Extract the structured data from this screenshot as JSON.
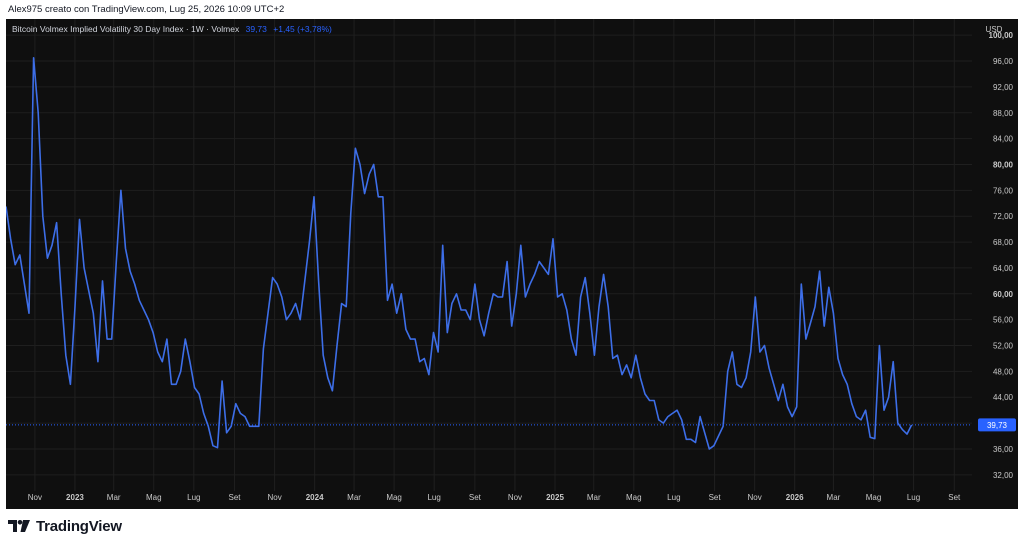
{
  "header": {
    "text": "Alex975 creato con TradingView.com, Lug 25, 2026 10:09 UTC+2"
  },
  "legend": {
    "title": "Bitcoin Volmex Implied Volatility 30 Day Index · 1W · Volmex",
    "last_value": "39,73",
    "change": "+1,45 (+3,78%)"
  },
  "footer": {
    "brand": "TradingView"
  },
  "colors": {
    "background": "#0f0f0f",
    "line": "#3d6ee8",
    "last_value_badge": "#2962ff",
    "grid": "#1f1f1f",
    "axis_text": "#c9c9c9"
  },
  "chart_data": {
    "type": "line",
    "title": "Bitcoin Volmex Implied Volatility 30 Day Index · 1W · Volmex",
    "currency": "USD",
    "ylim": [
      29.5,
      102.5
    ],
    "yticks": [
      "32,00",
      "36,00",
      "40,00",
      "44,00",
      "48,00",
      "52,00",
      "56,00",
      "60,00",
      "64,00",
      "68,00",
      "72,00",
      "76,00",
      "80,00",
      "84,00",
      "88,00",
      "92,00",
      "96,00",
      "100,00"
    ],
    "ytick_values": [
      32,
      36,
      40,
      44,
      48,
      52,
      56,
      60,
      64,
      68,
      72,
      76,
      80,
      84,
      88,
      92,
      96,
      100
    ],
    "bold_yticks": [
      "40,00",
      "60,00",
      "80,00",
      "100,00"
    ],
    "x_start": "2022-09-18",
    "x_end": "2026-09-28",
    "xticks": [
      {
        "date": "2022-11-01",
        "label": "Nov",
        "bold": false
      },
      {
        "date": "2023-01-01",
        "label": "2023",
        "bold": true
      },
      {
        "date": "2023-03-01",
        "label": "Mar",
        "bold": false
      },
      {
        "date": "2023-05-01",
        "label": "Mag",
        "bold": false
      },
      {
        "date": "2023-07-01",
        "label": "Lug",
        "bold": false
      },
      {
        "date": "2023-09-01",
        "label": "Set",
        "bold": false
      },
      {
        "date": "2023-11-01",
        "label": "Nov",
        "bold": false
      },
      {
        "date": "2024-01-01",
        "label": "2024",
        "bold": true
      },
      {
        "date": "2024-03-01",
        "label": "Mar",
        "bold": false
      },
      {
        "date": "2024-05-01",
        "label": "Mag",
        "bold": false
      },
      {
        "date": "2024-07-01",
        "label": "Lug",
        "bold": false
      },
      {
        "date": "2024-09-01",
        "label": "Set",
        "bold": false
      },
      {
        "date": "2024-11-01",
        "label": "Nov",
        "bold": false
      },
      {
        "date": "2025-01-01",
        "label": "2025",
        "bold": true
      },
      {
        "date": "2025-03-01",
        "label": "Mar",
        "bold": false
      },
      {
        "date": "2025-05-01",
        "label": "Mag",
        "bold": false
      },
      {
        "date": "2025-07-01",
        "label": "Lug",
        "bold": false
      },
      {
        "date": "2025-09-01",
        "label": "Set",
        "bold": false
      },
      {
        "date": "2025-11-01",
        "label": "Nov",
        "bold": false
      },
      {
        "date": "2026-01-01",
        "label": "2026",
        "bold": true
      },
      {
        "date": "2026-03-01",
        "label": "Mar",
        "bold": false
      },
      {
        "date": "2026-05-01",
        "label": "Mag",
        "bold": false
      },
      {
        "date": "2026-07-01",
        "label": "Lug",
        "bold": false
      },
      {
        "date": "2026-09-01",
        "label": "Set",
        "bold": false
      }
    ],
    "series": [
      {
        "values": [
          {
            "x": "2022-09-18",
            "y": 73.5
          },
          {
            "x": "2022-09-25",
            "y": 68.5
          },
          {
            "x": "2022-10-02",
            "y": 64.5
          },
          {
            "x": "2022-10-09",
            "y": 66.0
          },
          {
            "x": "2022-10-23",
            "y": 57.0
          },
          {
            "x": "2022-10-30",
            "y": 96.5
          },
          {
            "x": "2022-11-06",
            "y": 88.0
          },
          {
            "x": "2022-11-13",
            "y": 72.0
          },
          {
            "x": "2022-11-20",
            "y": 65.5
          },
          {
            "x": "2022-11-27",
            "y": 67.5
          },
          {
            "x": "2022-12-04",
            "y": 71.0
          },
          {
            "x": "2022-12-11",
            "y": 60.0
          },
          {
            "x": "2022-12-18",
            "y": 50.5
          },
          {
            "x": "2022-12-25",
            "y": 46.0
          },
          {
            "x": "2023-01-01",
            "y": 58.0
          },
          {
            "x": "2023-01-08",
            "y": 71.5
          },
          {
            "x": "2023-01-15",
            "y": 64.0
          },
          {
            "x": "2023-01-22",
            "y": 60.5
          },
          {
            "x": "2023-01-29",
            "y": 57.0
          },
          {
            "x": "2023-02-05",
            "y": 49.5
          },
          {
            "x": "2023-02-12",
            "y": 62.0
          },
          {
            "x": "2023-02-19",
            "y": 53.0
          },
          {
            "x": "2023-02-26",
            "y": 53.0
          },
          {
            "x": "2023-03-05",
            "y": 65.0
          },
          {
            "x": "2023-03-12",
            "y": 76.0
          },
          {
            "x": "2023-03-19",
            "y": 67.0
          },
          {
            "x": "2023-03-26",
            "y": 63.5
          },
          {
            "x": "2023-04-02",
            "y": 61.5
          },
          {
            "x": "2023-04-09",
            "y": 59.0
          },
          {
            "x": "2023-04-16",
            "y": 57.5
          },
          {
            "x": "2023-04-23",
            "y": 56.0
          },
          {
            "x": "2023-04-30",
            "y": 54.0
          },
          {
            "x": "2023-05-07",
            "y": 51.0
          },
          {
            "x": "2023-05-14",
            "y": 49.5
          },
          {
            "x": "2023-05-21",
            "y": 53.0
          },
          {
            "x": "2023-05-28",
            "y": 46.0
          },
          {
            "x": "2023-06-04",
            "y": 46.0
          },
          {
            "x": "2023-06-11",
            "y": 48.0
          },
          {
            "x": "2023-06-18",
            "y": 53.0
          },
          {
            "x": "2023-06-25",
            "y": 49.5
          },
          {
            "x": "2023-07-02",
            "y": 45.5
          },
          {
            "x": "2023-07-09",
            "y": 44.5
          },
          {
            "x": "2023-07-16",
            "y": 41.5
          },
          {
            "x": "2023-07-23",
            "y": 39.5
          },
          {
            "x": "2023-07-30",
            "y": 36.5
          },
          {
            "x": "2023-08-06",
            "y": 36.2
          },
          {
            "x": "2023-08-13",
            "y": 46.5
          },
          {
            "x": "2023-08-20",
            "y": 38.5
          },
          {
            "x": "2023-08-27",
            "y": 39.5
          },
          {
            "x": "2023-09-03",
            "y": 43.0
          },
          {
            "x": "2023-09-10",
            "y": 41.5
          },
          {
            "x": "2023-09-17",
            "y": 41.0
          },
          {
            "x": "2023-09-24",
            "y": 39.5
          },
          {
            "x": "2023-10-01",
            "y": 39.5
          },
          {
            "x": "2023-10-08",
            "y": 39.5
          },
          {
            "x": "2023-10-15",
            "y": 51.5
          },
          {
            "x": "2023-10-22",
            "y": 57.0
          },
          {
            "x": "2023-10-29",
            "y": 62.5
          },
          {
            "x": "2023-11-05",
            "y": 61.5
          },
          {
            "x": "2023-11-12",
            "y": 59.5
          },
          {
            "x": "2023-11-19",
            "y": 56.0
          },
          {
            "x": "2023-11-26",
            "y": 57.0
          },
          {
            "x": "2023-12-03",
            "y": 58.5
          },
          {
            "x": "2023-12-10",
            "y": 56.0
          },
          {
            "x": "2023-12-17",
            "y": 62.0
          },
          {
            "x": "2023-12-24",
            "y": 68.0
          },
          {
            "x": "2023-12-31",
            "y": 75.0
          },
          {
            "x": "2024-01-07",
            "y": 62.0
          },
          {
            "x": "2024-01-14",
            "y": 50.5
          },
          {
            "x": "2024-01-21",
            "y": 47.0
          },
          {
            "x": "2024-01-28",
            "y": 45.0
          },
          {
            "x": "2024-02-04",
            "y": 52.0
          },
          {
            "x": "2024-02-11",
            "y": 58.5
          },
          {
            "x": "2024-02-18",
            "y": 58.0
          },
          {
            "x": "2024-02-25",
            "y": 72.5
          },
          {
            "x": "2024-03-03",
            "y": 82.5
          },
          {
            "x": "2024-03-10",
            "y": 80.0
          },
          {
            "x": "2024-03-17",
            "y": 75.5
          },
          {
            "x": "2024-03-24",
            "y": 78.5
          },
          {
            "x": "2024-03-31",
            "y": 80.0
          },
          {
            "x": "2024-04-07",
            "y": 75.0
          },
          {
            "x": "2024-04-14",
            "y": 75.0
          },
          {
            "x": "2024-04-21",
            "y": 59.0
          },
          {
            "x": "2024-04-28",
            "y": 61.5
          },
          {
            "x": "2024-05-05",
            "y": 57.0
          },
          {
            "x": "2024-05-12",
            "y": 60.0
          },
          {
            "x": "2024-05-19",
            "y": 54.5
          },
          {
            "x": "2024-05-26",
            "y": 53.0
          },
          {
            "x": "2024-06-02",
            "y": 53.0
          },
          {
            "x": "2024-06-09",
            "y": 49.5
          },
          {
            "x": "2024-06-16",
            "y": 50.0
          },
          {
            "x": "2024-06-23",
            "y": 47.5
          },
          {
            "x": "2024-06-30",
            "y": 54.0
          },
          {
            "x": "2024-07-07",
            "y": 51.0
          },
          {
            "x": "2024-07-14",
            "y": 67.5
          },
          {
            "x": "2024-07-21",
            "y": 54.0
          },
          {
            "x": "2024-07-28",
            "y": 58.5
          },
          {
            "x": "2024-08-04",
            "y": 60.0
          },
          {
            "x": "2024-08-11",
            "y": 57.5
          },
          {
            "x": "2024-08-18",
            "y": 57.5
          },
          {
            "x": "2024-08-25",
            "y": 56.0
          },
          {
            "x": "2024-09-01",
            "y": 61.5
          },
          {
            "x": "2024-09-08",
            "y": 56.0
          },
          {
            "x": "2024-09-15",
            "y": 53.5
          },
          {
            "x": "2024-09-22",
            "y": 57.0
          },
          {
            "x": "2024-09-29",
            "y": 60.0
          },
          {
            "x": "2024-10-06",
            "y": 59.5
          },
          {
            "x": "2024-10-13",
            "y": 59.5
          },
          {
            "x": "2024-10-20",
            "y": 65.0
          },
          {
            "x": "2024-10-27",
            "y": 55.0
          },
          {
            "x": "2024-11-03",
            "y": 60.0
          },
          {
            "x": "2024-11-10",
            "y": 67.5
          },
          {
            "x": "2024-11-17",
            "y": 59.5
          },
          {
            "x": "2024-11-24",
            "y": 61.5
          },
          {
            "x": "2024-12-01",
            "y": 63.0
          },
          {
            "x": "2024-12-08",
            "y": 65.0
          },
          {
            "x": "2024-12-15",
            "y": 64.0
          },
          {
            "x": "2024-12-22",
            "y": 63.0
          },
          {
            "x": "2024-12-29",
            "y": 68.5
          },
          {
            "x": "2025-01-05",
            "y": 59.5
          },
          {
            "x": "2025-01-12",
            "y": 60.0
          },
          {
            "x": "2025-01-19",
            "y": 57.5
          },
          {
            "x": "2025-01-26",
            "y": 53.0
          },
          {
            "x": "2025-02-02",
            "y": 50.5
          },
          {
            "x": "2025-02-09",
            "y": 59.5
          },
          {
            "x": "2025-02-16",
            "y": 62.5
          },
          {
            "x": "2025-02-23",
            "y": 57.0
          },
          {
            "x": "2025-03-02",
            "y": 50.5
          },
          {
            "x": "2025-03-09",
            "y": 58.0
          },
          {
            "x": "2025-03-16",
            "y": 63.0
          },
          {
            "x": "2025-03-23",
            "y": 58.0
          },
          {
            "x": "2025-03-30",
            "y": 50.0
          },
          {
            "x": "2025-04-06",
            "y": 50.5
          },
          {
            "x": "2025-04-13",
            "y": 47.5
          },
          {
            "x": "2025-04-20",
            "y": 49.0
          },
          {
            "x": "2025-04-27",
            "y": 47.0
          },
          {
            "x": "2025-05-04",
            "y": 50.5
          },
          {
            "x": "2025-05-11",
            "y": 47.0
          },
          {
            "x": "2025-05-18",
            "y": 44.5
          },
          {
            "x": "2025-05-25",
            "y": 43.5
          },
          {
            "x": "2025-06-01",
            "y": 43.5
          },
          {
            "x": "2025-06-08",
            "y": 40.5
          },
          {
            "x": "2025-06-15",
            "y": 40.0
          },
          {
            "x": "2025-06-22",
            "y": 41.0
          },
          {
            "x": "2025-06-29",
            "y": 41.5
          },
          {
            "x": "2025-07-06",
            "y": 42.0
          },
          {
            "x": "2025-07-13",
            "y": 40.5
          },
          {
            "x": "2025-07-20",
            "y": 37.5
          },
          {
            "x": "2025-07-27",
            "y": 37.5
          },
          {
            "x": "2025-08-03",
            "y": 37.0
          },
          {
            "x": "2025-08-10",
            "y": 41.0
          },
          {
            "x": "2025-08-17",
            "y": 38.5
          },
          {
            "x": "2025-08-24",
            "y": 36.0
          },
          {
            "x": "2025-08-31",
            "y": 36.5
          },
          {
            "x": "2025-09-07",
            "y": 38.0
          },
          {
            "x": "2025-09-14",
            "y": 39.5
          },
          {
            "x": "2025-09-21",
            "y": 48.0
          },
          {
            "x": "2025-09-28",
            "y": 51.0
          },
          {
            "x": "2025-10-05",
            "y": 46.0
          },
          {
            "x": "2025-10-12",
            "y": 45.5
          },
          {
            "x": "2025-10-19",
            "y": 47.0
          },
          {
            "x": "2025-10-26",
            "y": 51.0
          },
          {
            "x": "2025-11-02",
            "y": 59.5
          },
          {
            "x": "2025-11-09",
            "y": 51.0
          },
          {
            "x": "2025-11-16",
            "y": 52.0
          },
          {
            "x": "2025-11-23",
            "y": 48.5
          },
          {
            "x": "2025-11-30",
            "y": 46.0
          },
          {
            "x": "2025-12-07",
            "y": 43.5
          },
          {
            "x": "2025-12-14",
            "y": 46.0
          },
          {
            "x": "2025-12-21",
            "y": 42.5
          },
          {
            "x": "2025-12-28",
            "y": 41.0
          },
          {
            "x": "2026-01-04",
            "y": 42.5
          },
          {
            "x": "2026-01-11",
            "y": 61.5
          },
          {
            "x": "2026-01-18",
            "y": 53.0
          },
          {
            "x": "2026-01-25",
            "y": 55.5
          },
          {
            "x": "2026-02-01",
            "y": 58.0
          },
          {
            "x": "2026-02-08",
            "y": 63.5
          },
          {
            "x": "2026-02-15",
            "y": 55.0
          },
          {
            "x": "2026-02-22",
            "y": 61.0
          },
          {
            "x": "2026-03-01",
            "y": 57.0
          },
          {
            "x": "2026-03-08",
            "y": 50.0
          },
          {
            "x": "2026-03-15",
            "y": 47.5
          },
          {
            "x": "2026-03-22",
            "y": 46.0
          },
          {
            "x": "2026-03-29",
            "y": 43.0
          },
          {
            "x": "2026-04-05",
            "y": 41.0
          },
          {
            "x": "2026-04-12",
            "y": 40.5
          },
          {
            "x": "2026-04-19",
            "y": 42.0
          },
          {
            "x": "2026-04-26",
            "y": 37.8
          },
          {
            "x": "2026-05-03",
            "y": 37.6
          },
          {
            "x": "2026-05-10",
            "y": 52.0
          },
          {
            "x": "2026-05-17",
            "y": 42.0
          },
          {
            "x": "2026-05-24",
            "y": 44.0
          },
          {
            "x": "2026-05-31",
            "y": 49.5
          },
          {
            "x": "2026-06-07",
            "y": 40.0
          },
          {
            "x": "2026-06-14",
            "y": 39.0
          },
          {
            "x": "2026-06-21",
            "y": 38.3
          },
          {
            "x": "2026-06-28",
            "y": 39.73
          }
        ]
      }
    ],
    "last_value": 39.73
  }
}
